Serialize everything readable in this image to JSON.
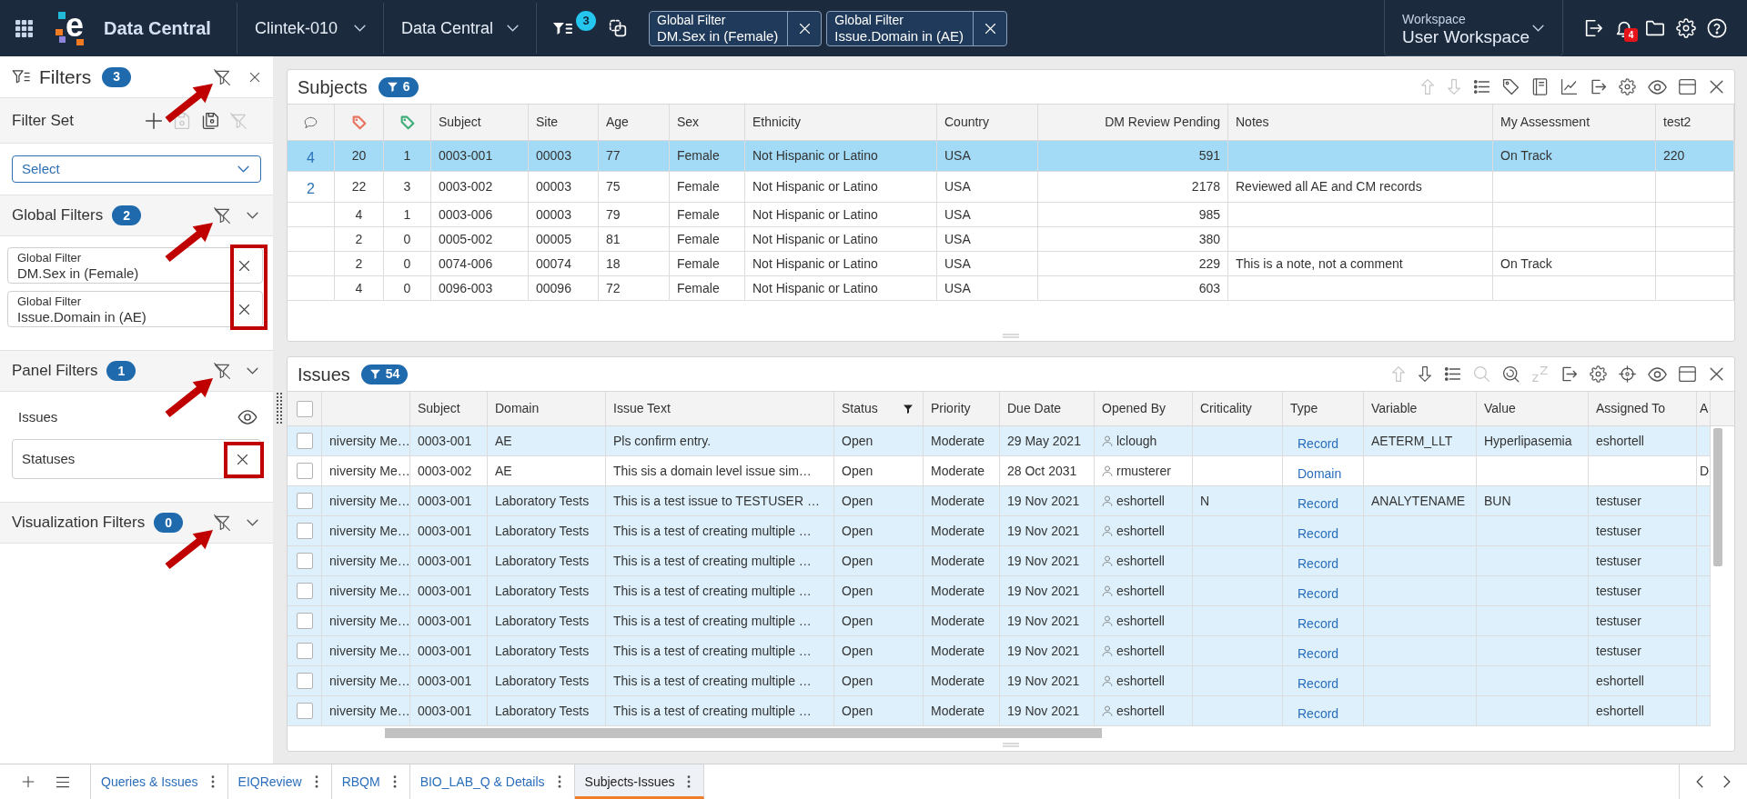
{
  "top_bar": {
    "logo_letter": "e",
    "app_name": "Data Central",
    "menus": [
      {
        "label": "Clintek-010"
      },
      {
        "label": "Data Central"
      }
    ],
    "filter_count": "3",
    "global_filters": [
      {
        "title": "Global Filter",
        "value": "DM.Sex in (Female)"
      },
      {
        "title": "Global Filter",
        "value": "Issue.Domain in (AE)"
      }
    ],
    "workspace": {
      "label": "Workspace",
      "value": "User Workspace"
    },
    "notification_count": "4"
  },
  "filters_panel": {
    "title": "Filters",
    "count": "3",
    "filter_set": {
      "title": "Filter Set",
      "tools": [
        {
          "kind": "plus",
          "disabled": false
        },
        {
          "kind": "save",
          "disabled": true
        },
        {
          "kind": "save-as",
          "disabled": false
        },
        {
          "kind": "filter-off",
          "disabled": true
        }
      ],
      "placeholder": "Select"
    },
    "sections": [
      {
        "title": "Global Filters",
        "count": "2",
        "expanded": true,
        "items": [
          {
            "kind": "chip",
            "title": "Global Filter",
            "value": "DM.Sex in (Female)"
          },
          {
            "kind": "chip",
            "title": "Global Filter",
            "value": "Issue.Domain in (AE)"
          }
        ]
      },
      {
        "title": "Panel Filters",
        "count": "1",
        "expanded": true,
        "items": [
          {
            "kind": "group",
            "label": "Issues"
          },
          {
            "kind": "field",
            "label": "Statuses"
          }
        ]
      },
      {
        "title": "Visualization Filters",
        "count": "0",
        "expanded": true
      }
    ]
  },
  "subjects_panel": {
    "title": "Subjects",
    "filter_count": "6",
    "tools": [
      {
        "kind": "arrow-up",
        "disabled": true
      },
      {
        "kind": "arrow-down",
        "disabled": true
      },
      {
        "kind": "list",
        "disabled": false
      },
      {
        "kind": "tag",
        "disabled": false
      },
      {
        "kind": "notebook",
        "disabled": false
      },
      {
        "kind": "line-chart",
        "disabled": false
      },
      {
        "kind": "export",
        "disabled": false
      },
      {
        "kind": "settings",
        "disabled": false
      },
      {
        "kind": "eye",
        "disabled": false
      },
      {
        "kind": "window",
        "disabled": false
      },
      {
        "kind": "close",
        "disabled": false
      }
    ],
    "table": {
      "columns": [
        {
          "kind": "comments"
        },
        {
          "kind": "tag",
          "color": "#e8735f"
        },
        {
          "kind": "tag",
          "color": "#3fae78"
        },
        {
          "kind": "text",
          "label": "Subject"
        },
        {
          "kind": "text",
          "label": "Site"
        },
        {
          "kind": "text",
          "label": "Age"
        },
        {
          "kind": "text",
          "label": "Sex"
        },
        {
          "kind": "text",
          "label": "Ethnicity"
        },
        {
          "kind": "text",
          "label": "Country"
        },
        {
          "kind": "number",
          "label": "DM Review Pending"
        },
        {
          "kind": "text",
          "label": "Notes"
        },
        {
          "kind": "text",
          "label": "My Assessment"
        },
        {
          "kind": "text",
          "label": "test2"
        }
      ],
      "rows": [
        {
          "selected": true,
          "cells": [
            "4",
            "20",
            "1",
            "0003-001",
            "00003",
            "77",
            "Female",
            "Not Hispanic or Latino",
            "USA",
            "591",
            null,
            "On Track",
            "220"
          ]
        },
        {
          "selected": false,
          "cells": [
            "2",
            "22",
            "3",
            "0003-002",
            "00003",
            "75",
            "Female",
            "Not Hispanic or Latino",
            "USA",
            "2178",
            "Reviewed all AE and CM records",
            null,
            null
          ]
        },
        {
          "selected": false,
          "cells": [
            null,
            "4",
            "1",
            "0003-006",
            "00003",
            "79",
            "Female",
            "Not Hispanic or Latino",
            "USA",
            "985",
            null,
            null,
            null
          ]
        },
        {
          "selected": false,
          "cells": [
            null,
            "2",
            "0",
            "0005-002",
            "00005",
            "81",
            "Female",
            "Not Hispanic or Latino",
            "USA",
            "380",
            null,
            null,
            null
          ]
        },
        {
          "selected": false,
          "cells": [
            null,
            "2",
            "0",
            "0074-006",
            "00074",
            "18",
            "Female",
            "Not Hispanic or Latino",
            "USA",
            "229",
            "This is a note, not a comment",
            "On Track",
            null
          ]
        },
        {
          "selected": false,
          "cells": [
            null,
            "4",
            "0",
            "0096-003",
            "00096",
            "72",
            "Female",
            "Not Hispanic or Latino",
            "USA",
            "603",
            null,
            null,
            null
          ]
        }
      ]
    }
  },
  "issues_panel": {
    "title": "Issues",
    "filter_count": "54",
    "tools": [
      {
        "kind": "arrow-up",
        "disabled": true
      },
      {
        "kind": "arrow-down",
        "disabled": false
      },
      {
        "kind": "list",
        "disabled": false
      },
      {
        "kind": "search",
        "disabled": true
      },
      {
        "kind": "spiral-search",
        "disabled": false
      },
      {
        "kind": "snooze",
        "disabled": true
      },
      {
        "kind": "export",
        "disabled": false
      },
      {
        "kind": "settings",
        "disabled": false
      },
      {
        "kind": "crosshair",
        "disabled": false
      },
      {
        "kind": "eye",
        "disabled": false
      },
      {
        "kind": "window",
        "disabled": false
      },
      {
        "kind": "close",
        "disabled": false
      }
    ],
    "table": {
      "select_all": {
        "checked": false
      },
      "columns": [
        {
          "kind": "text",
          "filtered": false
        },
        {
          "kind": "text",
          "label": "Subject",
          "filtered": false
        },
        {
          "kind": "text",
          "label": "Domain",
          "filtered": false
        },
        {
          "kind": "text",
          "label": "Issue Text",
          "filtered": false
        },
        {
          "kind": "text",
          "label": "Status",
          "filtered": true
        },
        {
          "kind": "text",
          "label": "Priority",
          "filtered": false
        },
        {
          "kind": "text",
          "label": "Due Date",
          "filtered": false
        },
        {
          "kind": "user",
          "label": "Opened By",
          "filtered": false
        },
        {
          "kind": "text",
          "label": "Criticality",
          "filtered": false
        },
        {
          "kind": "link",
          "label": "Type",
          "filtered": false
        },
        {
          "kind": "text",
          "label": "Variable",
          "filtered": false
        },
        {
          "kind": "text",
          "label": "Value",
          "filtered": false
        },
        {
          "kind": "text",
          "label": "Assigned To",
          "filtered": false
        },
        {
          "kind": "text",
          "label": "A",
          "filtered": false
        }
      ],
      "rows": [
        {
          "checked": false,
          "highlighted": true,
          "cells": [
            "niversity Me…",
            "0003-001",
            "AE",
            "Pls confirm entry.",
            "Open",
            "Moderate",
            "29 May 2021",
            "lclough",
            null,
            "Record",
            "AETERM_LLT",
            "Hyperlipasemia",
            "eshortell",
            null
          ]
        },
        {
          "checked": false,
          "highlighted": false,
          "cells": [
            "niversity Me…",
            "0003-002",
            "AE",
            "This sis a domain level issue sim…",
            "Open",
            "Moderate",
            "28 Oct 2031",
            "rmusterer",
            null,
            "Domain",
            null,
            null,
            null,
            "D"
          ]
        },
        {
          "checked": false,
          "highlighted": true,
          "cells": [
            "niversity Me…",
            "0003-001",
            "Laboratory Tests",
            "This is a test issue to TESTUSER …",
            "Open",
            "Moderate",
            "19 Nov 2021",
            "eshortell",
            "N",
            "Record",
            "ANALYTENAME",
            "BUN",
            "testuser",
            null
          ]
        },
        {
          "checked": false,
          "highlighted": true,
          "cells": [
            "niversity Me…",
            "0003-001",
            "Laboratory Tests",
            "This is a test of creating multiple …",
            "Open",
            "Moderate",
            "19 Nov 2021",
            "eshortell",
            null,
            "Record",
            null,
            null,
            "testuser",
            null
          ]
        },
        {
          "checked": false,
          "highlighted": true,
          "cells": [
            "niversity Me…",
            "0003-001",
            "Laboratory Tests",
            "This is a test of creating multiple …",
            "Open",
            "Moderate",
            "19 Nov 2021",
            "eshortell",
            null,
            "Record",
            null,
            null,
            "testuser",
            null
          ]
        },
        {
          "checked": false,
          "highlighted": true,
          "cells": [
            "niversity Me…",
            "0003-001",
            "Laboratory Tests",
            "This is a test of creating multiple …",
            "Open",
            "Moderate",
            "19 Nov 2021",
            "eshortell",
            null,
            "Record",
            null,
            null,
            "testuser",
            null
          ]
        },
        {
          "checked": false,
          "highlighted": true,
          "cells": [
            "niversity Me…",
            "0003-001",
            "Laboratory Tests",
            "This is a test of creating multiple …",
            "Open",
            "Moderate",
            "19 Nov 2021",
            "eshortell",
            null,
            "Record",
            null,
            null,
            "testuser",
            null
          ]
        },
        {
          "checked": false,
          "highlighted": true,
          "cells": [
            "niversity Me…",
            "0003-001",
            "Laboratory Tests",
            "This is a test of creating multiple …",
            "Open",
            "Moderate",
            "19 Nov 2021",
            "eshortell",
            null,
            "Record",
            null,
            null,
            "testuser",
            null
          ]
        },
        {
          "checked": false,
          "highlighted": true,
          "cells": [
            "niversity Me…",
            "0003-001",
            "Laboratory Tests",
            "This is a test of creating multiple …",
            "Open",
            "Moderate",
            "19 Nov 2021",
            "eshortell",
            null,
            "Record",
            null,
            null,
            "eshortell",
            null
          ]
        },
        {
          "checked": false,
          "highlighted": true,
          "cells": [
            "niversity Me…",
            "0003-001",
            "Laboratory Tests",
            "This is a test of creating multiple …",
            "Open",
            "Moderate",
            "19 Nov 2021",
            "eshortell",
            null,
            "Record",
            null,
            null,
            "eshortell",
            null
          ]
        }
      ]
    }
  },
  "bottom_tabs": [
    {
      "label": "Queries & Issues",
      "selected": false
    },
    {
      "label": "EIQReview",
      "selected": false
    },
    {
      "label": "RBQM",
      "selected": false
    },
    {
      "label": "BIO_LAB_Q & Details",
      "selected": false
    },
    {
      "label": "Subjects-Issues",
      "selected": true
    }
  ]
}
